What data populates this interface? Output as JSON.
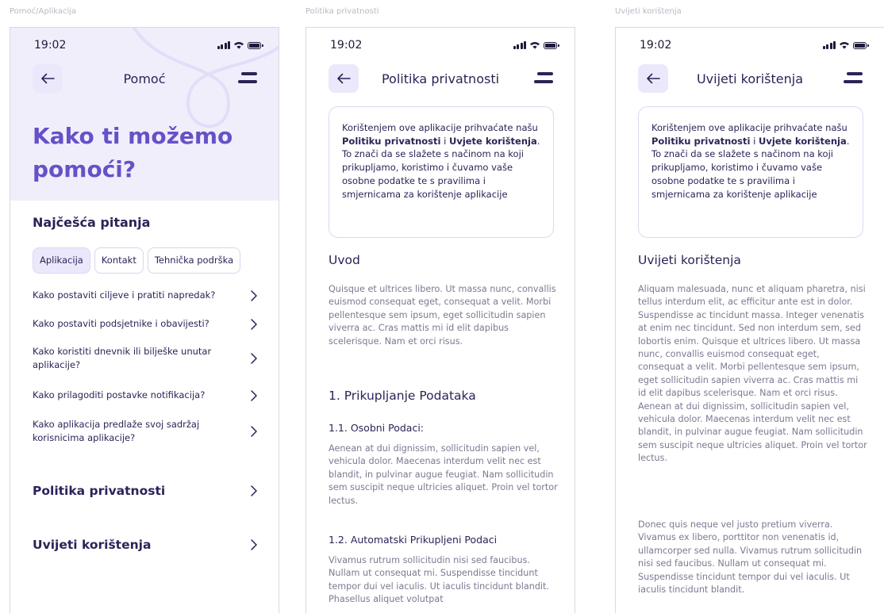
{
  "frames": [
    {
      "label": "Pomoć/Aplikacija"
    },
    {
      "label": "Politika privatnosti"
    },
    {
      "label": "Uvijeti korištenja"
    }
  ],
  "status": {
    "time": "19:02"
  },
  "help": {
    "header_title": "Pomoć",
    "hero_title": "Kako ti možemo pomoći?",
    "faq_title": "Najčešća pitanja",
    "chips": [
      "Aplikacija",
      "Kontakt",
      "Tehnička podrška"
    ],
    "faq": [
      "Kako postaviti ciljeve i pratiti napredak?",
      "Kako postaviti podsjetnike i obavijesti?",
      "Kako koristiti dnevnik ili bilješke unutar aplikacije?",
      "Kako prilagoditi postavke notifikacija?",
      "Kako aplikacija predlaže svoj sadržaj korisnicima aplikacije?"
    ],
    "links": [
      "Politika privatnosti",
      "Uvijeti korištenja"
    ]
  },
  "notice": {
    "t1": "Korištenjem ove aplikacije prihvaćate našu ",
    "b1": "Politiku privatnosti",
    "t2": " i ",
    "b2": "Uvjete korištenja",
    "t3": ". To znači da se slažete s načinom na koji prikupljamo, koristimo i čuvamo vaše osobne podatke te s pravilima i smjernicama za korištenje aplikacije"
  },
  "privacy": {
    "header_title": "Politika privatnosti",
    "intro_heading": "Uvod",
    "intro_text": "Quisque et ultrices libero. Ut massa nunc, convallis euismod consequat eget, consequat a velit. Morbi pellentesque sem ipsum, eget sollicitudin sapien viverra ac. Cras mattis mi id elit dapibus scelerisque. Nam et orci risus.",
    "section1_heading": "1. Prikupljanje Podataka",
    "sub1_heading": "1.1. Osobni Podaci:",
    "sub1_text": "Aenean at dui dignissim, sollicitudin sapien vel, vehicula dolor. Maecenas interdum velit nec est blandit, in pulvinar augue feugiat. Nam sollicitudin sem suscipit neque ultricies aliquet. Proin vel tortor lectus.",
    "sub2_heading": "1.2. Automatski Prikupljeni Podaci",
    "sub2_text": "Vivamus rutrum sollicitudin nisi sed faucibus. Nullam ut consequat mi. Suspendisse tincidunt tempor dui vel iaculis. Ut iaculis tincidunt blandit. Phasellus aliquet volutpat"
  },
  "terms": {
    "header_title": "Uvijeti korištenja",
    "heading": "Uvijeti korištenja",
    "p1": "Aliquam malesuada, nunc et aliquam pharetra, nisi tellus interdum elit, ac efficitur ante est in dolor. Suspendisse ac tincidunt massa. Integer venenatis at enim nec tincidunt. Sed non interdum sem, sed lobortis enim. Quisque et ultrices libero. Ut massa nunc, convallis euismod consequat eget, consequat a velit. Morbi pellentesque sem ipsum, eget sollicitudin sapien viverra ac. Cras mattis mi id elit dapibus scelerisque. Nam et orci risus. Aenean at dui dignissim, sollicitudin sapien vel, vehicula dolor. Maecenas interdum velit nec est blandit, in pulvinar augue feugiat. Nam sollicitudin sem suscipit neque ultricies aliquet. Proin vel tortor lectus.",
    "p2": "Donec quis neque vel justo pretium viverra. Vivamus ex libero, porttitor non venenatis id, ullamcorper sed nulla. Vivamus rutrum sollicitudin nisi sed faucibus. Nullam ut consequat mi. Suspendisse tincidunt tempor dui vel iaculis. Ut iaculis tincidunt blandit."
  },
  "colors": {
    "accent": "#6651c7",
    "accent_light": "#ece8fb",
    "text": "#2b2357",
    "muted": "#7c7992"
  },
  "icons": [
    "back-arrow-icon",
    "menu-icon",
    "chevron-right-icon",
    "signal-icon",
    "wifi-icon",
    "battery-icon"
  ]
}
